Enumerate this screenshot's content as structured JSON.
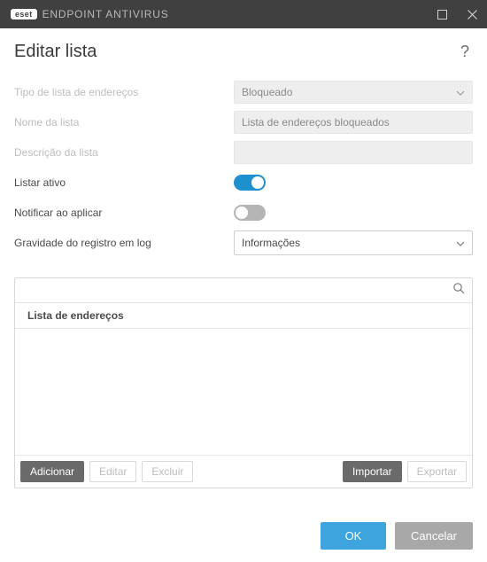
{
  "brand": {
    "logo": "eset",
    "product": "ENDPOINT ANTIVIRUS"
  },
  "page": {
    "title": "Editar lista"
  },
  "fields": {
    "listType": {
      "label": "Tipo de lista de endereços",
      "value": "Bloqueado"
    },
    "listName": {
      "label": "Nome da lista",
      "value": "Lista de endereços bloqueados"
    },
    "listDesc": {
      "label": "Descrição da lista",
      "value": ""
    },
    "activeList": {
      "label": "Listar ativo",
      "on": true
    },
    "notifyApply": {
      "label": "Notificar ao aplicar",
      "on": false
    },
    "logSeverity": {
      "label": "Gravidade do registro em log",
      "value": "Informações"
    }
  },
  "listPanel": {
    "searchPlaceholder": "",
    "columnHeader": "Lista de endereços",
    "rows": []
  },
  "toolbar": {
    "add": "Adicionar",
    "edit": "Editar",
    "delete": "Excluir",
    "import": "Importar",
    "export": "Exportar"
  },
  "footer": {
    "ok": "OK",
    "cancel": "Cancelar"
  }
}
